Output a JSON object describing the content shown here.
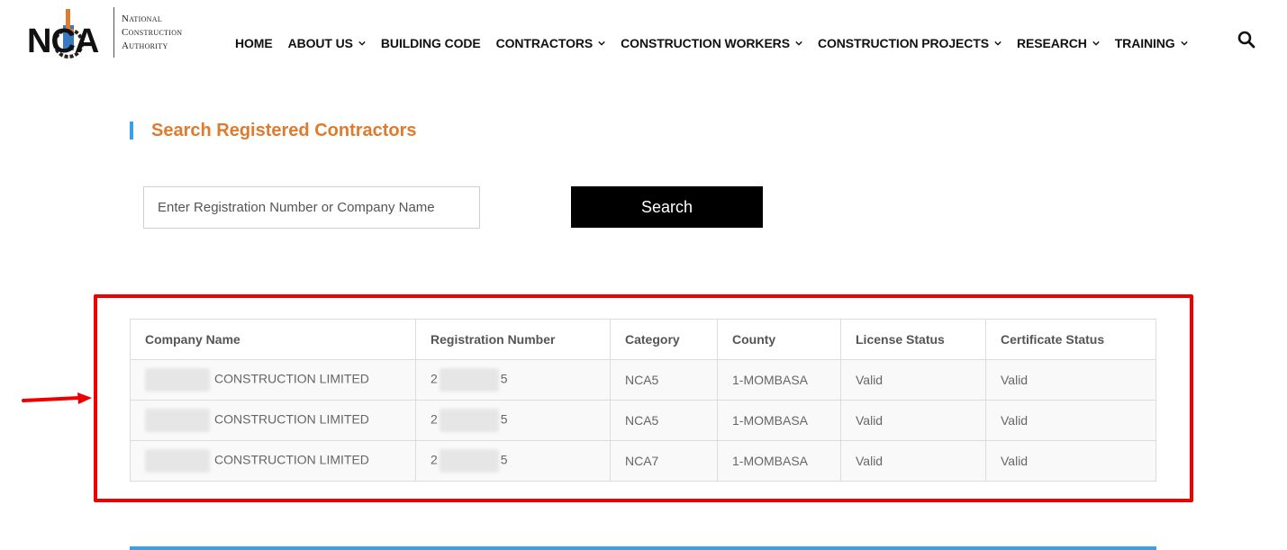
{
  "logo": {
    "letters": "NCA",
    "line1": "National",
    "line2": "Construction",
    "line3": "Authority"
  },
  "nav": {
    "items": [
      {
        "label": "HOME",
        "dropdown": false
      },
      {
        "label": "ABOUT US",
        "dropdown": true
      },
      {
        "label": "BUILDING CODE",
        "dropdown": false
      },
      {
        "label": "CONTRACTORS",
        "dropdown": true
      },
      {
        "label": "CONSTRUCTION WORKERS",
        "dropdown": true
      },
      {
        "label": "CONSTRUCTION PROJECTS",
        "dropdown": true
      },
      {
        "label": "RESEARCH",
        "dropdown": true
      },
      {
        "label": "TRAINING",
        "dropdown": true
      }
    ]
  },
  "page": {
    "title": "Search Registered Contractors"
  },
  "search": {
    "placeholder": "Enter Registration Number or Company Name",
    "value": "",
    "button_label": "Search"
  },
  "table": {
    "headers": [
      "Company Name",
      "Registration Number",
      "Category",
      "County",
      "License Status",
      "Certificate Status"
    ],
    "rows": [
      {
        "company_suffix": "CONSTRUCTION LIMITED",
        "reg_prefix": "2",
        "reg_suffix": "5",
        "category": "NCA5",
        "county": "1-MOMBASA",
        "license": "Valid",
        "certificate": "Valid"
      },
      {
        "company_suffix": "CONSTRUCTION LIMITED",
        "reg_prefix": "2",
        "reg_suffix": "5",
        "category": "NCA5",
        "county": "1-MOMBASA",
        "license": "Valid",
        "certificate": "Valid"
      },
      {
        "company_suffix": "CONSTRUCTION LIMITED",
        "reg_prefix": "2",
        "reg_suffix": "5",
        "category": "NCA7",
        "county": "1-MOMBASA",
        "license": "Valid",
        "certificate": "Valid"
      }
    ]
  },
  "colors": {
    "accent_orange": "#e07a2c",
    "accent_blue": "#3aa0e8",
    "highlight_red": "#ee0000",
    "button_bg": "#000000"
  }
}
